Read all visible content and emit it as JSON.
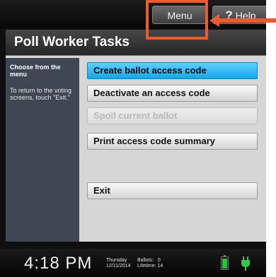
{
  "topbar": {
    "menu_label": "Menu",
    "help_symbol": "?",
    "help_label": "Help"
  },
  "page": {
    "title": "Poll Worker Tasks"
  },
  "sidebar": {
    "heading": "Choose from the menu",
    "instructions": "To return to the voting screens, touch \"Exit.\""
  },
  "tasks": [
    {
      "label": "Create ballot access code",
      "state": "selected"
    },
    {
      "label": "Deactivate an access code",
      "state": "enabled"
    },
    {
      "label": "Spoil current ballot",
      "state": "disabled"
    },
    {
      "label": "Print access code summary",
      "state": "enabled"
    },
    {
      "label": "Exit",
      "state": "enabled"
    }
  ],
  "status": {
    "time": "4:18 PM",
    "day": "Thursday",
    "date": "12/11/2014",
    "ballots_label": "Ballots:",
    "ballots_value": "0",
    "lifetime_label": "Lifetime:",
    "lifetime_value": "14",
    "icons": [
      "battery-icon",
      "power-plug-icon"
    ]
  },
  "colors": {
    "selected_task": "#13a8e8",
    "annotation": "#f0592a",
    "battery": "#29c13a"
  }
}
